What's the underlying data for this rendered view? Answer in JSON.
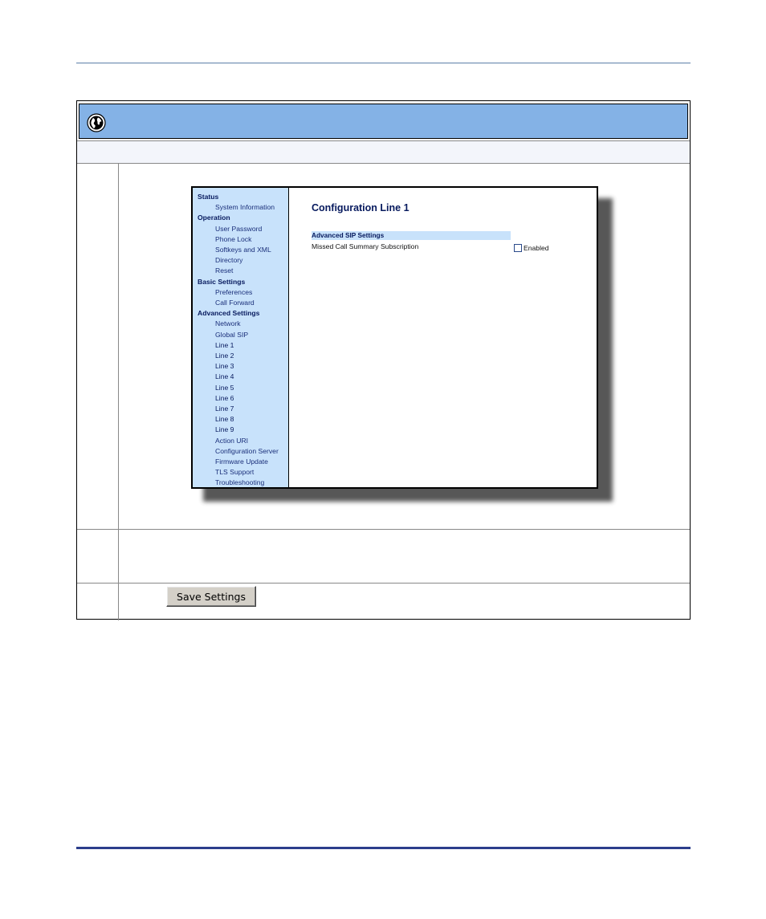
{
  "config_page": {
    "title": "Configuration Line 1",
    "sip_section": "Advanced SIP Settings",
    "missed_call_label": "Missed Call Summary Subscription",
    "enabled_label": "Enabled",
    "enabled_checked": false
  },
  "nav": {
    "status": "Status",
    "system_information": "System Information",
    "operation": "Operation",
    "user_password": "User Password",
    "phone_lock": "Phone Lock",
    "softkeys_xml": "Softkeys and XML",
    "directory": "Directory",
    "reset": "Reset",
    "basic_settings": "Basic Settings",
    "preferences": "Preferences",
    "call_forward": "Call Forward",
    "advanced_settings": "Advanced Settings",
    "network": "Network",
    "global_sip": "Global SIP",
    "line1": "Line 1",
    "line2": "Line 2",
    "line3": "Line 3",
    "line4": "Line 4",
    "line5": "Line 5",
    "line6": "Line 6",
    "line7": "Line 7",
    "line8": "Line 8",
    "line9": "Line 9",
    "action_uri": "Action URI",
    "configuration_server": "Configuration Server",
    "firmware_update": "Firmware Update",
    "tls_support": "TLS Support",
    "troubleshooting": "Troubleshooting"
  },
  "buttons": {
    "save": "Save Settings"
  },
  "colors": {
    "header_blue": "#84b2e6",
    "nav_bg": "#c8e2fb",
    "title_navy": "#071a5e",
    "rule_blue": "#2c3e8c"
  },
  "icons": {
    "header": "globe-icon"
  }
}
